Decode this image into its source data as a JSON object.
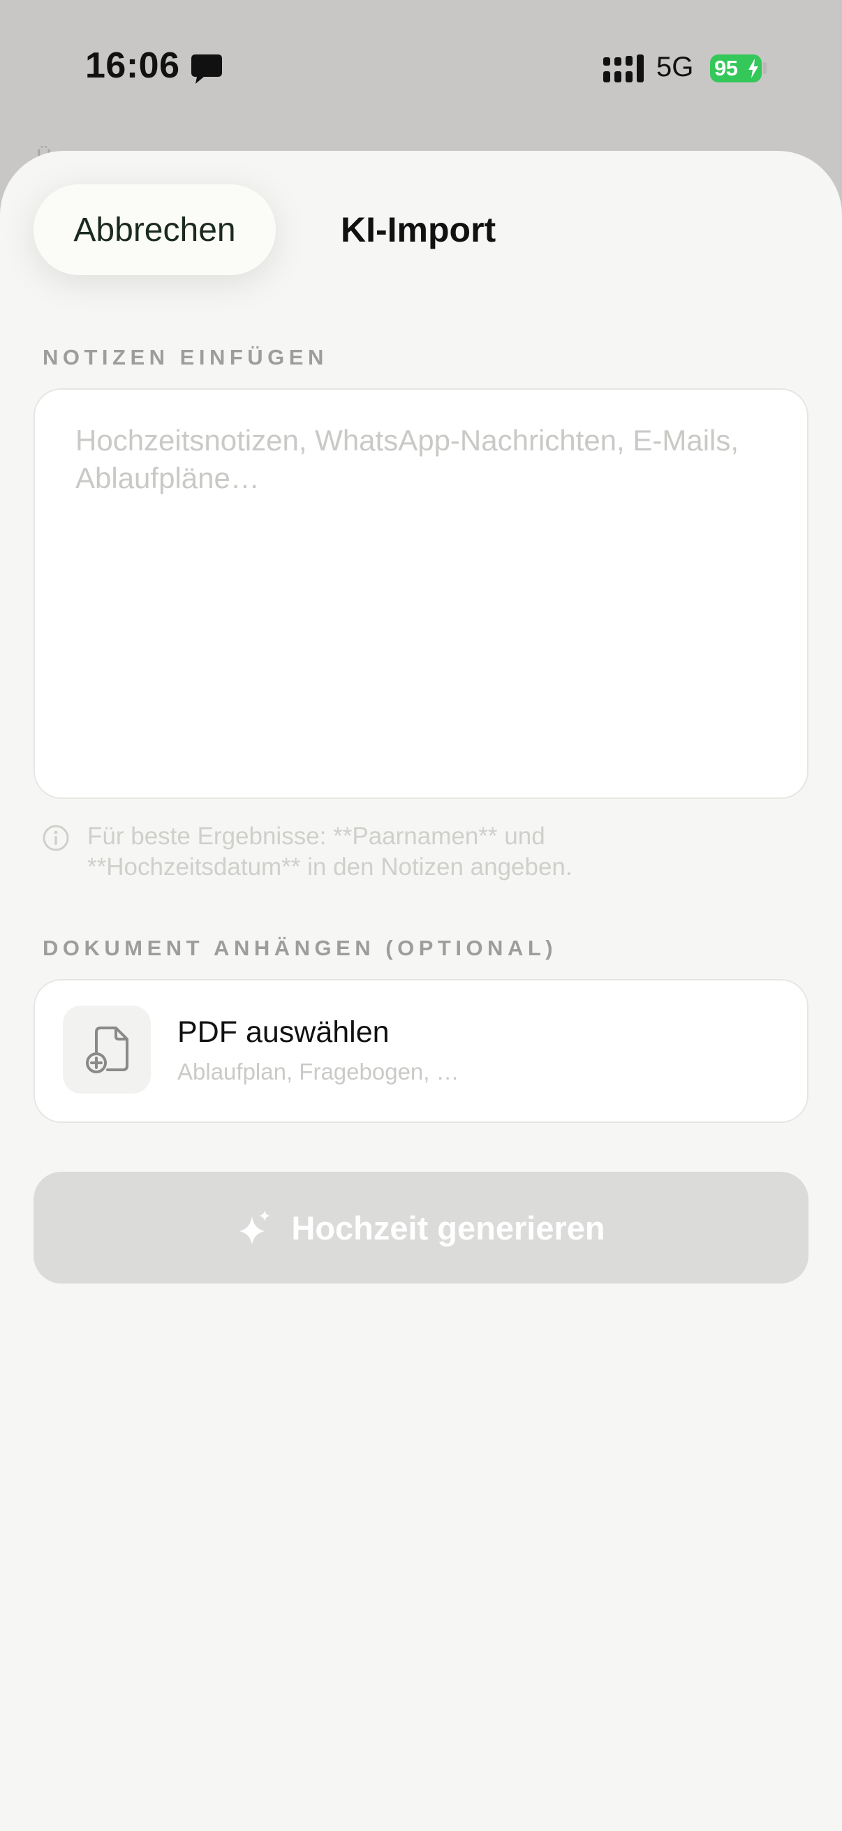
{
  "status_bar": {
    "time": "16:06",
    "network": "5G",
    "battery": "95"
  },
  "background": {
    "partial_text": "Ü"
  },
  "header": {
    "cancel_label": "Abbrechen",
    "title": "KI-Import"
  },
  "notes_section": {
    "label": "NOTIZEN EINFÜGEN",
    "value": "",
    "placeholder": "Hochzeitsnotizen, WhatsApp-Nachrichten, E-Mails, Ablaufpläne…",
    "hint": "Für beste Ergebnisse: **Paarnamen** und **Hochzeitsdatum** in den Notizen angeben."
  },
  "document_section": {
    "label": "DOKUMENT ANHÄNGEN (OPTIONAL)",
    "pdf_title": "PDF auswählen",
    "pdf_subtitle": "Ablaufplan, Fragebogen, …"
  },
  "generate_button": {
    "label": "Hochzeit generieren"
  },
  "colors": {
    "battery": "#34c759",
    "sheet_background": "#f6f6f4",
    "disabled_button": "#dbdbda"
  },
  "icons": [
    "message-icon",
    "signal-icon",
    "battery-bolt-icon",
    "info-icon",
    "document-add-icon",
    "sparkle-icon"
  ]
}
